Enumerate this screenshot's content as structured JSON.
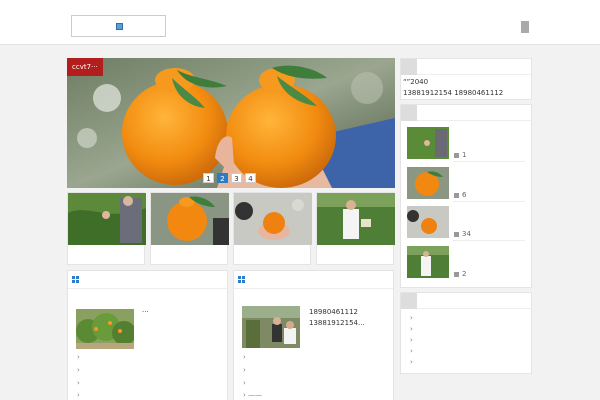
{
  "header": {
    "logo_icon": "logo-icon",
    "menu_icon": "menu-icon"
  },
  "slider": {
    "tag": "ccvt7···",
    "dots": [
      "1",
      "2",
      "3",
      "4"
    ],
    "active_dot": 2
  },
  "thumbs": [
    {
      "alt": ""
    },
    {
      "alt": ""
    },
    {
      "alt": ""
    },
    {
      "alt": ""
    }
  ],
  "box_left": {
    "caption": "···",
    "chevrons": [
      "›",
      "›",
      "›",
      "›"
    ]
  },
  "box_right": {
    "phone1": "18980461112",
    "phone2": "13881912154...",
    "chevrons": [
      "›",
      "›",
      "›"
    ],
    "last_item": "›  ——"
  },
  "side_contact": {
    "line1": "“”2040",
    "line2": "13881912154 18980461112"
  },
  "side_recent": {
    "items": [
      {
        "likes": "1"
      },
      {
        "likes": "6"
      },
      {
        "likes": "34"
      },
      {
        "likes": "2"
      }
    ]
  },
  "side_links": {
    "chevrons": [
      "›",
      "›",
      "›",
      "›",
      "›"
    ]
  },
  "colors": {
    "accent": "#2b7bc9",
    "tag": "#b21d1d"
  }
}
